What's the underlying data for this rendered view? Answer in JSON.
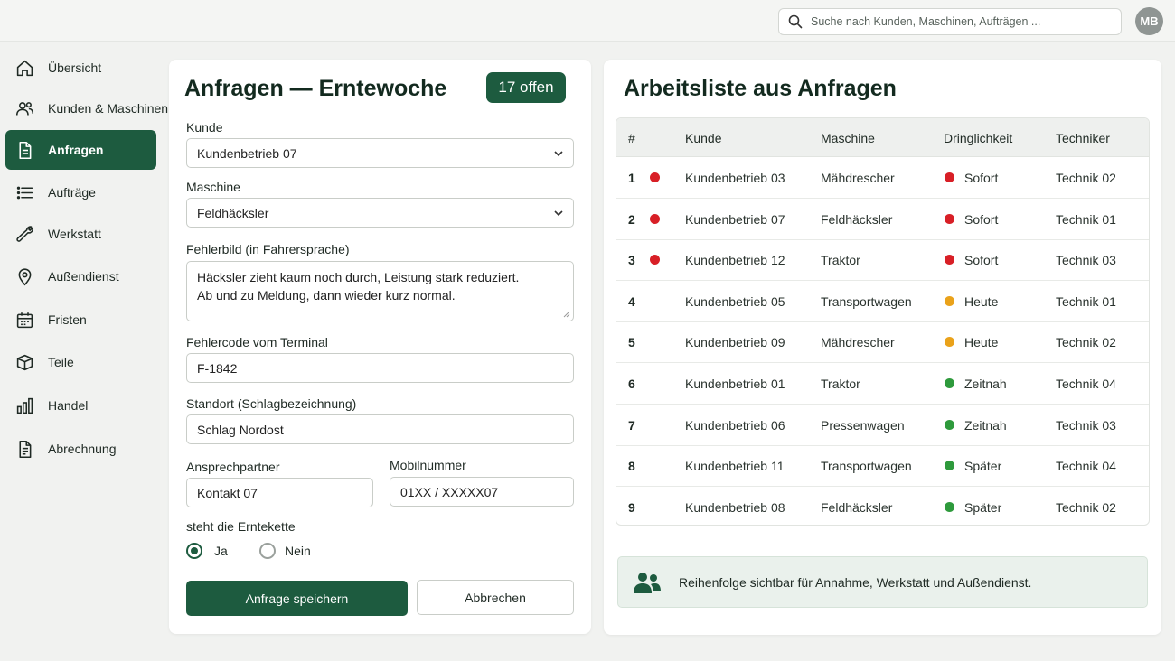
{
  "search": {
    "placeholder": "Suche nach Kunden, Maschinen, Aufträgen ..."
  },
  "user": {
    "initials": "MB"
  },
  "sidebar": {
    "items": [
      {
        "label": "Übersicht",
        "icon": "home-icon",
        "active": false
      },
      {
        "label": "Kunden & Maschinen",
        "icon": "users-icon",
        "active": false
      },
      {
        "label": "Anfragen",
        "icon": "document-icon",
        "active": true
      },
      {
        "label": "Aufträge",
        "icon": "list-icon",
        "active": false
      },
      {
        "label": "Werkstatt",
        "icon": "wrench-icon",
        "active": false
      },
      {
        "label": "Außendienst",
        "icon": "map-pin-icon",
        "active": false
      },
      {
        "label": "Fristen",
        "icon": "calendar-icon",
        "active": false
      },
      {
        "label": "Teile",
        "icon": "box-icon",
        "active": false
      },
      {
        "label": "Handel",
        "icon": "bar-chart-icon",
        "active": false
      },
      {
        "label": "Abrechnung",
        "icon": "invoice-icon",
        "active": false
      }
    ]
  },
  "form": {
    "title": "Anfragen — Erntewoche",
    "badge": "17 offen",
    "customer": {
      "label": "Kunde",
      "value": "Kundenbetrieb 07"
    },
    "machine": {
      "label": "Maschine",
      "value": "Feldhäcksler"
    },
    "fault": {
      "label": "Fehlerbild (in Fahrersprache)",
      "line1": "Häcksler zieht kaum noch durch, Leistung stark reduziert.",
      "line2": "Ab und zu Meldung, dann wieder kurz normal."
    },
    "code": {
      "label": "Fehlercode vom Terminal",
      "value": "F-1842"
    },
    "location": {
      "label": "Standort (Schlagbezeichnung)",
      "value": "Schlag Nordost"
    },
    "contact": {
      "label": "Ansprechpartner",
      "value": "Kontakt 07"
    },
    "mobile": {
      "label": "Mobilnummer",
      "value": "01XX / XXXXX07"
    },
    "harvest": {
      "label": "steht die Erntekette",
      "yes": "Ja",
      "no": "Nein",
      "selected": "Ja"
    },
    "save_label": "Anfrage speichern",
    "cancel_label": "Abbrechen"
  },
  "worklist": {
    "title": "Arbeitsliste aus Anfragen",
    "columns": [
      "#",
      "Kunde",
      "Maschine",
      "Dringlichkeit",
      "Techniker"
    ],
    "rows": [
      {
        "num": "1",
        "customer": "Kundenbetrieb 03",
        "machine": "Mähdrescher",
        "urgency": "Sofort",
        "tech": "Technik 02",
        "flag": true,
        "color": "#d81f26"
      },
      {
        "num": "2",
        "customer": "Kundenbetrieb 07",
        "machine": "Feldhäcksler",
        "urgency": "Sofort",
        "tech": "Technik 01",
        "flag": true,
        "color": "#d81f26"
      },
      {
        "num": "3",
        "customer": "Kundenbetrieb 12",
        "machine": "Traktor",
        "urgency": "Sofort",
        "tech": "Technik 03",
        "flag": true,
        "color": "#d81f26"
      },
      {
        "num": "4",
        "customer": "Kundenbetrieb 05",
        "machine": "Transportwagen",
        "urgency": "Heute",
        "tech": "Technik 01",
        "flag": false,
        "color": "#eaa21a"
      },
      {
        "num": "5",
        "customer": "Kundenbetrieb 09",
        "machine": "Mähdrescher",
        "urgency": "Heute",
        "tech": "Technik 02",
        "flag": false,
        "color": "#eaa21a"
      },
      {
        "num": "6",
        "customer": "Kundenbetrieb 01",
        "machine": "Traktor",
        "urgency": "Zeitnah",
        "tech": "Technik 04",
        "flag": false,
        "color": "#2e9a3c"
      },
      {
        "num": "7",
        "customer": "Kundenbetrieb 06",
        "machine": "Pressenwagen",
        "urgency": "Zeitnah",
        "tech": "Technik 03",
        "flag": false,
        "color": "#2e9a3c"
      },
      {
        "num": "8",
        "customer": "Kundenbetrieb 11",
        "machine": "Transportwagen",
        "urgency": "Später",
        "tech": "Technik 04",
        "flag": false,
        "color": "#2e9a3c"
      },
      {
        "num": "9",
        "customer": "Kundenbetrieb 08",
        "machine": "Feldhäcksler",
        "urgency": "Später",
        "tech": "Technik 02",
        "flag": false,
        "color": "#2e9a3c"
      }
    ],
    "info": "Reihenfolge sichtbar für Annahme, Werkstatt und Außendienst."
  },
  "colors": {
    "accent": "#1d5b3f",
    "urgent": "#d81f26",
    "today": "#eaa21a",
    "later": "#2e9a3c"
  }
}
